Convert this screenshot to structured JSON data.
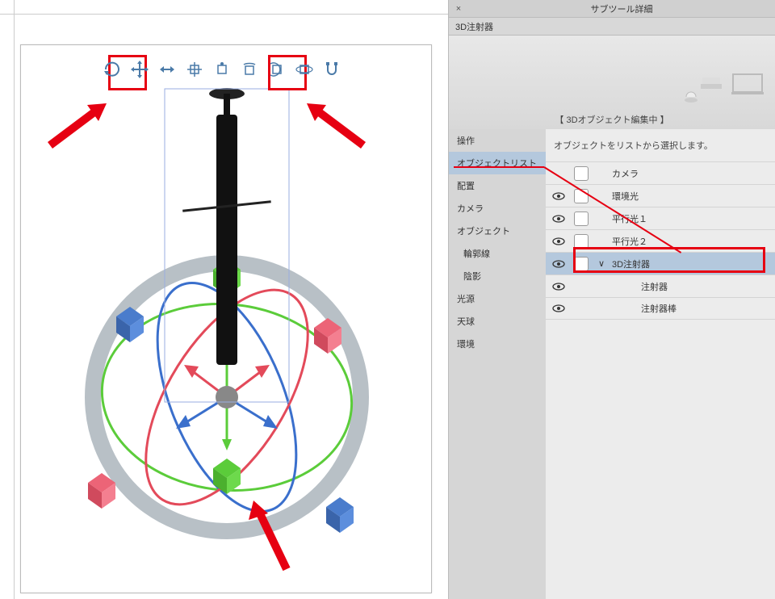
{
  "panel": {
    "title": "サブツール詳細",
    "subtitle": "3D注射器",
    "close_glyph": "×",
    "banner_status": "【 3Dオブジェクト編集中 】"
  },
  "sidebar": {
    "items": [
      {
        "label": "操作",
        "selected": false
      },
      {
        "label": "オブジェクトリスト",
        "selected": true
      },
      {
        "label": "配置",
        "selected": false
      },
      {
        "label": "カメラ",
        "selected": false
      },
      {
        "label": "オブジェクト",
        "selected": false
      },
      {
        "label": "輪郭線",
        "selected": false,
        "sub": true
      },
      {
        "label": "陰影",
        "selected": false,
        "sub": true
      },
      {
        "label": "光源",
        "selected": false
      },
      {
        "label": "天球",
        "selected": false
      },
      {
        "label": "環境",
        "selected": false
      }
    ]
  },
  "content": {
    "hint": "オブジェクトをリストから選択します。",
    "rows": [
      {
        "eye": false,
        "check": true,
        "caret": "",
        "label": "カメラ",
        "selected": false,
        "child": false
      },
      {
        "eye": true,
        "check": true,
        "caret": "",
        "label": "環境光",
        "selected": false,
        "child": false
      },
      {
        "eye": true,
        "check": true,
        "caret": "",
        "label": "平行光１",
        "selected": false,
        "child": false
      },
      {
        "eye": true,
        "check": true,
        "caret": "",
        "label": "平行光２",
        "selected": false,
        "child": false
      },
      {
        "eye": true,
        "check": true,
        "caret": "∨",
        "label": "3D注射器",
        "selected": true,
        "child": false
      },
      {
        "eye": true,
        "check": false,
        "caret": "",
        "label": "注射器",
        "selected": false,
        "child": true
      },
      {
        "eye": true,
        "check": false,
        "caret": "",
        "label": "注射器棒",
        "selected": false,
        "child": true
      }
    ]
  },
  "toolbar_icons": [
    "camera-rotate",
    "camera-pan",
    "camera-zoom",
    "object-move",
    "object-scale",
    "object-rotate",
    "object-ground",
    "object-free",
    "magnet"
  ]
}
